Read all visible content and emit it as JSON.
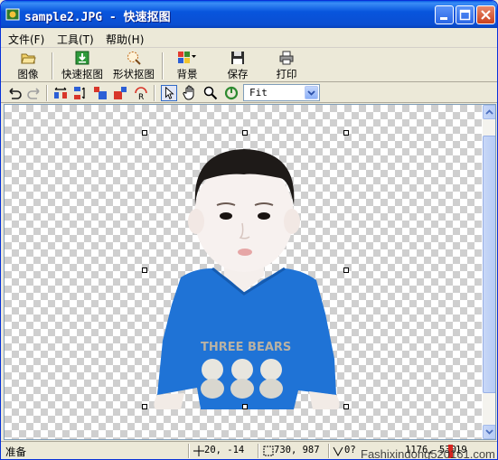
{
  "window": {
    "title": "sample2.JPG - 快速抠图",
    "accent": "#0a4ed2"
  },
  "menu": {
    "items": [
      {
        "label": "文件(F)"
      },
      {
        "label": "工具(T)"
      },
      {
        "label": "帮助(H)"
      }
    ]
  },
  "toolbar": {
    "image_label": "图像",
    "quick_cutout_label": "快速抠图",
    "shape_cutout_label": "形状抠图",
    "background_label": "背景",
    "save_label": "保存",
    "print_label": "打印"
  },
  "toolbar2": {
    "zoom_value": "Fit",
    "icons": [
      "undo-icon",
      "redo-icon",
      "flip-horizontal-icon",
      "flip-vertical-icon",
      "rotate-left-icon",
      "rotate-right-icon",
      "rotate-free-icon",
      "pointer-icon",
      "hand-icon",
      "zoom-icon",
      "refresh-icon"
    ]
  },
  "status": {
    "ready": "准备",
    "cursor_pos": "20, -14",
    "image_size": "730, 987",
    "angle": "0?",
    "extra": "1176, 530",
    "level": "19",
    "watermark": "Fashixindong520161.com"
  }
}
